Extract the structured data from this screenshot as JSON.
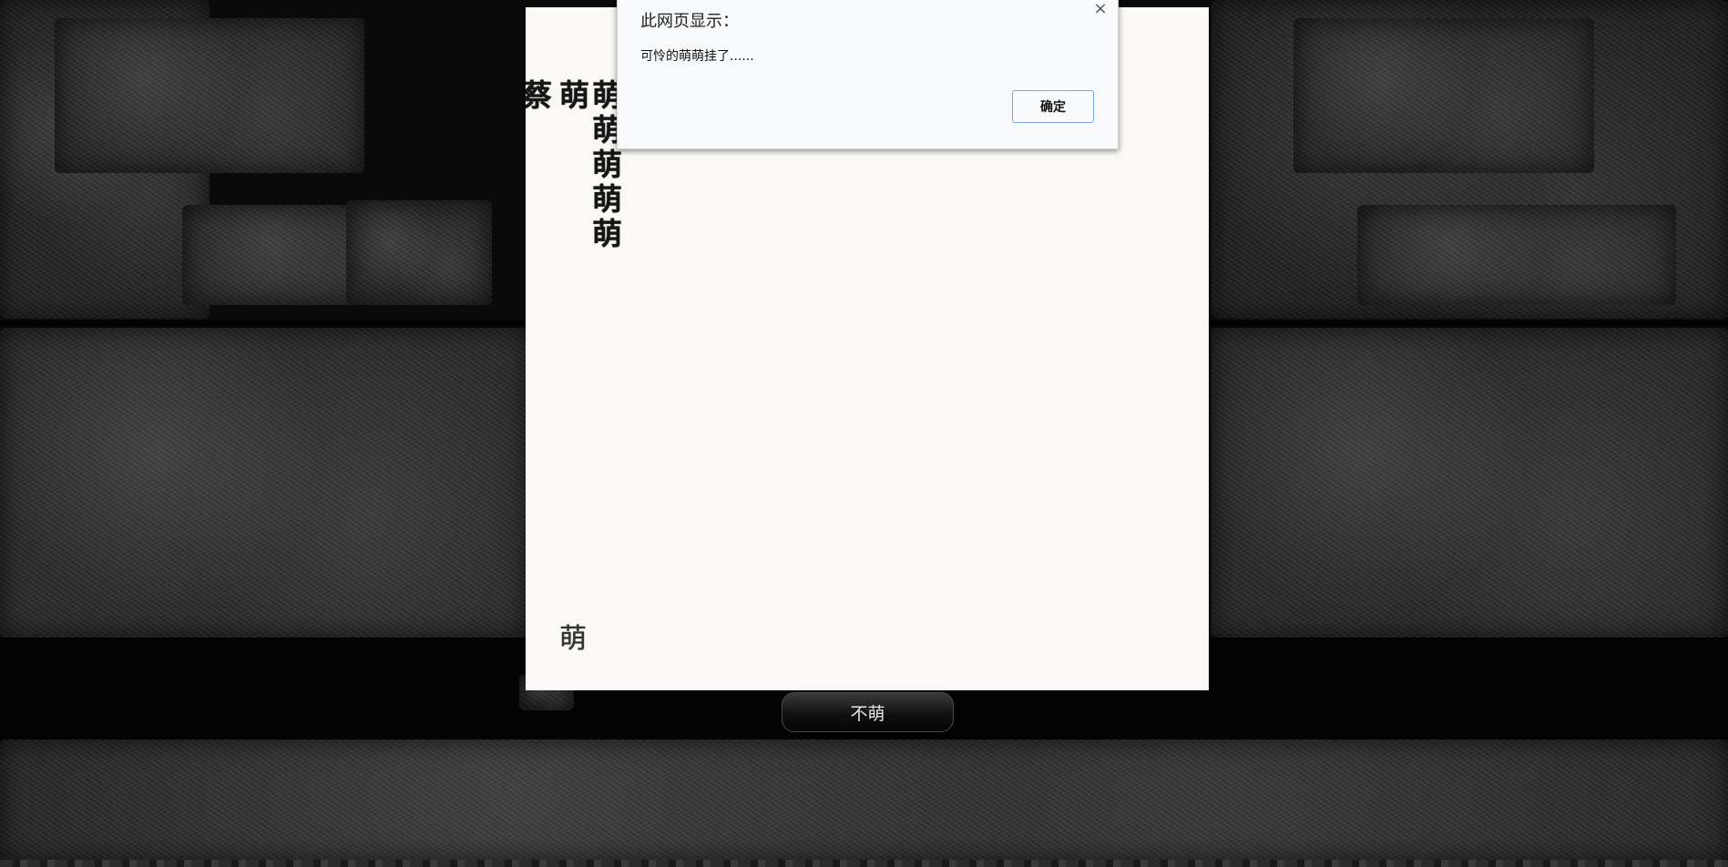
{
  "board": {
    "row1": [
      "蔡",
      "萌",
      "萌"
    ],
    "column": [
      "萌",
      "萌",
      "萌",
      "萌"
    ],
    "bottom_glyph": "萌"
  },
  "button": {
    "label": "不萌"
  },
  "dialog": {
    "title": "此网页显示：",
    "message": "可怜的萌萌挂了......",
    "ok_label": "确定",
    "close_icon": "×"
  }
}
